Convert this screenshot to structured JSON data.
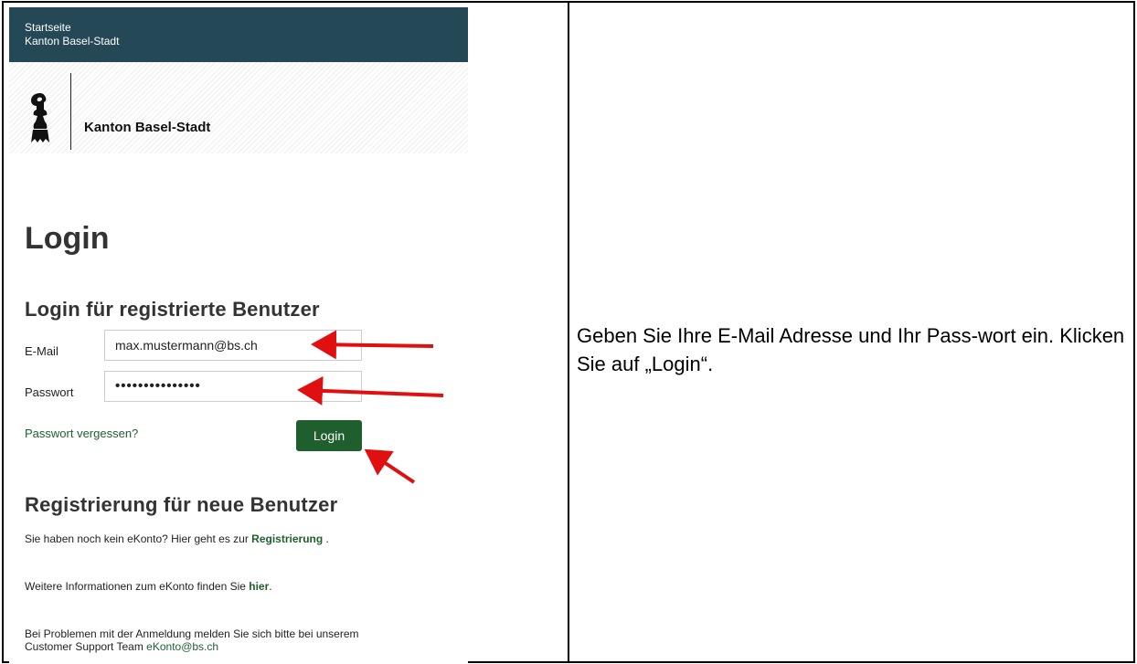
{
  "topbar": {
    "line1": "Startseite",
    "line2": "Kanton Basel-Stadt"
  },
  "brand": {
    "name": "Kanton Basel-Stadt"
  },
  "page": {
    "title": "Login"
  },
  "login": {
    "heading": "Login für registrierte Benutzer",
    "email_label": "E-Mail",
    "email_value": "max.mustermann@bs.ch",
    "password_label": "Passwort",
    "password_value": "•••••••••••••••",
    "forgot_link": "Passwort vergessen?",
    "login_button": "Login"
  },
  "register": {
    "heading": "Registrierung für neue Benutzer",
    "line1_prefix": "Sie haben noch kein eKonto? Hier geht es zur ",
    "line1_link": "Registrierung",
    "line1_suffix": " .",
    "line2_prefix": "Weitere Informationen zum eKonto finden Sie ",
    "line2_link": "hier",
    "line2_suffix": ".",
    "line3": "Bei Problemen mit der Anmeldung melden Sie sich bitte bei unserem",
    "line4_prefix": "Customer Support Team ",
    "line4_link": "eKonto@bs.ch"
  },
  "instruction": {
    "text": "Geben Sie Ihre E-Mail Adresse und Ihr Pass-wort ein. Klicken Sie auf „Login“."
  },
  "colors": {
    "topbar": "#254856",
    "accent_green": "#1f5f2d",
    "arrow_red": "#e01010"
  }
}
